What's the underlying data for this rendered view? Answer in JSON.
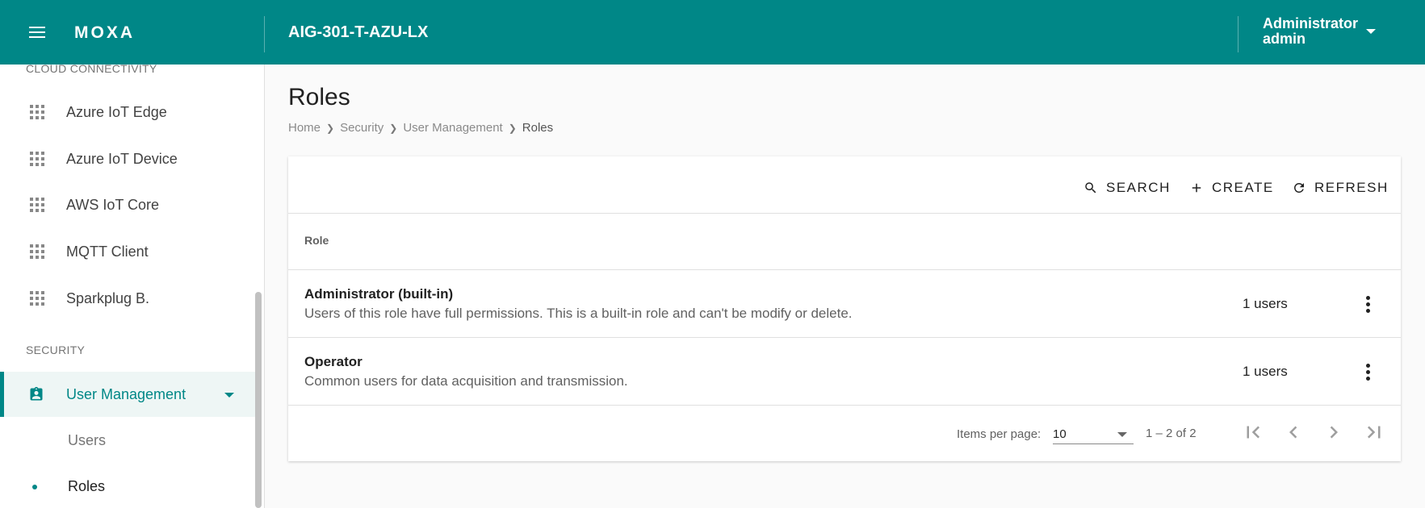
{
  "header": {
    "logo": "MOXA",
    "device_name": "AIG-301-T-AZU-LX",
    "user_role": "Administrator",
    "user_name": "admin",
    "brand_color": "#008787"
  },
  "sidebar": {
    "section_cloud": "CLOUD CONNECTIVITY",
    "cloud_items": [
      {
        "label": "Azure IoT Edge",
        "icon": "apps-icon"
      },
      {
        "label": "Azure IoT Device",
        "icon": "apps-icon"
      },
      {
        "label": "AWS IoT Core",
        "icon": "apps-icon"
      },
      {
        "label": "MQTT Client",
        "icon": "apps-icon"
      },
      {
        "label": "Sparkplug B.",
        "icon": "apps-icon"
      }
    ],
    "section_security": "SECURITY",
    "user_management": {
      "label": "User Management",
      "icon": "badge-icon",
      "expanded": true
    },
    "sub_items": [
      {
        "label": "Users",
        "active": false
      },
      {
        "label": "Roles",
        "active": true
      }
    ]
  },
  "main": {
    "title": "Roles",
    "breadcrumb": [
      "Home",
      "Security",
      "User Management",
      "Roles"
    ],
    "toolbar": {
      "search_label": "SEARCH",
      "create_label": "CREATE",
      "refresh_label": "REFRESH"
    },
    "table": {
      "column_header": "Role",
      "rows": [
        {
          "name": "Administrator (built-in)",
          "description": "Users of this role have full permissions. This is a built-in role and can't be modify or delete.",
          "users": "1 users"
        },
        {
          "name": "Operator",
          "description": "Common users for data acquisition and transmission.",
          "users": "1 users"
        }
      ]
    },
    "paginator": {
      "items_per_page_label": "Items per page:",
      "items_per_page_value": "10",
      "range_label": "1 – 2 of 2"
    }
  }
}
